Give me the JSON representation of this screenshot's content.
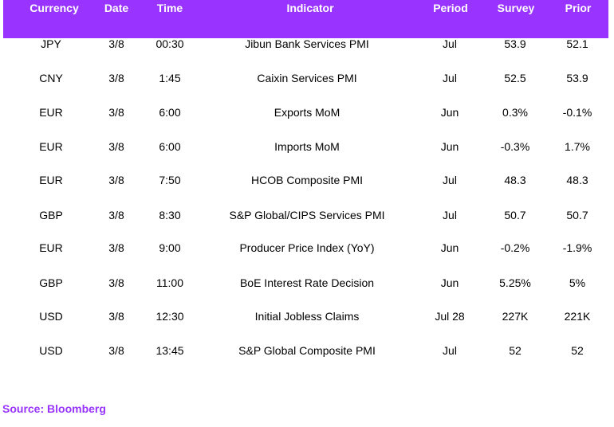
{
  "table": {
    "columns": [
      "Currency",
      "Date",
      "Time",
      "Indicator",
      "Period",
      "Survey",
      "Prior"
    ],
    "rows": [
      [
        "JPY",
        "3/8",
        "00:30",
        "Jibun Bank Services PMI",
        "Jul",
        "53.9",
        "52.1"
      ],
      [
        "CNY",
        "3/8",
        "1:45",
        "Caixin Services PMI",
        "Jul",
        "52.5",
        "53.9"
      ],
      [
        "EUR",
        "3/8",
        "6:00",
        "Exports MoM",
        "Jun",
        "0.3%",
        "-0.1%"
      ],
      [
        "EUR",
        "3/8",
        "6:00",
        "Imports MoM",
        "Jun",
        "-0.3%",
        "1.7%"
      ],
      [
        "EUR",
        "3/8",
        "7:50",
        "HCOB Composite PMI",
        "Jul",
        "48.3",
        "48.3"
      ],
      [
        "GBP",
        "3/8",
        "8:30",
        "S&P Global/CIPS Services PMI",
        "Jul",
        "50.7",
        "50.7"
      ],
      [
        "EUR",
        "3/8",
        "9:00",
        "Producer Price Index (YoY)",
        "Jun",
        "-0.2%",
        "-1.9%"
      ],
      [
        "GBP",
        "3/8",
        "11:00",
        "BoE Interest Rate Decision",
        "Jun",
        "5.25%",
        "5%"
      ],
      [
        "USD",
        "3/8",
        "12:30",
        "Initial Jobless Claims",
        "Jul 28",
        "227K",
        "221K"
      ],
      [
        "USD",
        "3/8",
        "13:45",
        "S&P Global Composite PMI",
        "Jul",
        "52",
        "52"
      ]
    ]
  },
  "source": "Source: Bloomberg",
  "colors": {
    "header_bg": "#9933ff",
    "header_text": "#ffffff",
    "source_text": "#9933ff"
  }
}
